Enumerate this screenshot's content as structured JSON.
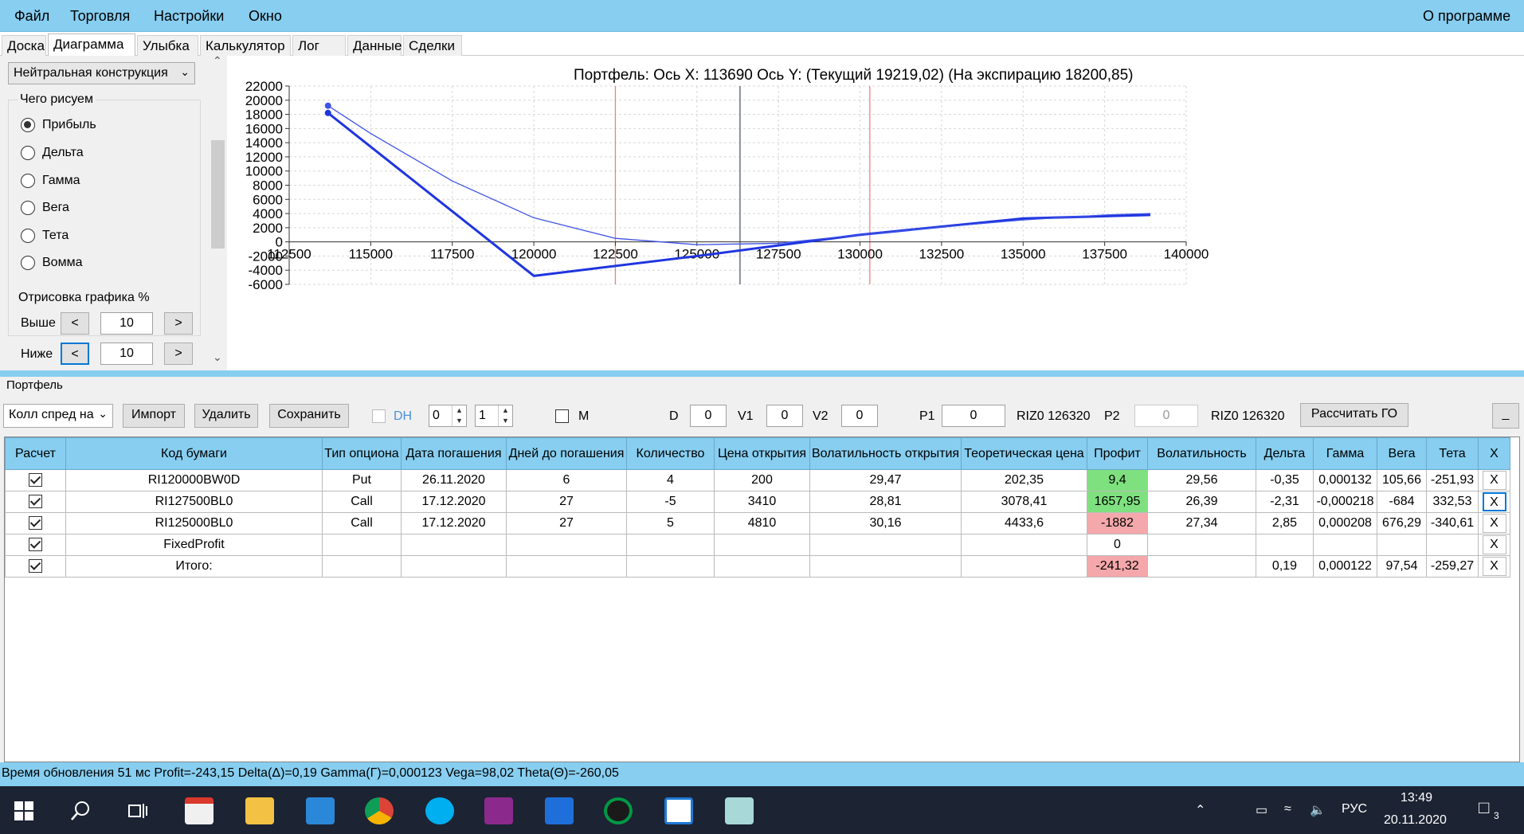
{
  "menu": {
    "file": "Файл",
    "trade": "Торговля",
    "settings": "Настройки",
    "window": "Окно",
    "about": "О программе"
  },
  "tabs": [
    "Доска",
    "Диаграмма",
    "Улыбка",
    "Калькулятор",
    "Лог",
    "Данные",
    "Сделки"
  ],
  "left_panel": {
    "construction": "Нейтральная конструкция",
    "draw_group_title": "Чего рисуем",
    "radios": [
      "Прибыль",
      "Дельта",
      "Гамма",
      "Вега",
      "Тета",
      "Вомма"
    ],
    "selected_radio": "Прибыль",
    "render_group_title": "Отрисовка графика %",
    "above_label": "Выше",
    "below_label": "Ниже",
    "prev": "<",
    "next": ">",
    "above_value": "10",
    "below_value": "10"
  },
  "chart_title": "Портфель: Ось X: 113690 Ось Y:  (Текущий 19219,02)  (На экспирацию 18200,85)",
  "chart_data": {
    "type": "line",
    "title": "Портфель: Ось X: 113690 Ось Y:  (Текущий 19219,02)  (На экспирацию 18200,85)",
    "xlim": [
      112500,
      140000
    ],
    "ylim": [
      -6000,
      22000
    ],
    "x_ticks": [
      112500,
      115000,
      117500,
      120000,
      122500,
      125000,
      127500,
      130000,
      132500,
      135000,
      137500,
      140000
    ],
    "y_ticks": [
      22000,
      20000,
      18000,
      16000,
      14000,
      12000,
      10000,
      8000,
      6000,
      4000,
      2000,
      0,
      -2000,
      -4000,
      -6000
    ],
    "grid": true,
    "current_price_line": 126320,
    "strike_lines": [
      122500,
      130300
    ],
    "series": [
      {
        "color": "#1f35e0",
        "width": 3,
        "x": [
          113690,
          120000,
          125000,
          130000,
          135000,
          138900
        ],
        "y": [
          18200,
          -4800,
          -2000,
          1000,
          3300,
          3800
        ]
      },
      {
        "color": "#3f54e6",
        "width": 1.3,
        "x": [
          113690,
          115000,
          117500,
          120000,
          122500,
          125000,
          127500,
          130000,
          132500,
          135000,
          137500,
          138900
        ],
        "y": [
          19219,
          15300,
          8600,
          3400,
          500,
          -400,
          -200,
          1000,
          2100,
          3100,
          3800,
          4000
        ]
      }
    ]
  },
  "portfolio": {
    "title": "Портфель",
    "strategy": "Колл спред на",
    "import": "Импорт",
    "delete": "Удалить",
    "save": "Сохранить",
    "dh": "DH",
    "spin1": "0",
    "spin2": "1",
    "m": "M",
    "d_label": "D",
    "d_value": "0",
    "v1_label": "V1",
    "v1_value": "0",
    "v2_label": "V2",
    "v2_value": "0",
    "p1_label": "P1",
    "p1_value": "0",
    "riz1": "RIZ0 126320",
    "p2_label": "P2",
    "p2_value": "0",
    "riz2": "RIZ0 126320",
    "calc": "Рассчитать ГО",
    "minimize": "_"
  },
  "table": {
    "headers": [
      "Расчет",
      "Код бумаги",
      "Тип опциона",
      "Дата погашения",
      "Дней до погашения",
      "Количество",
      "Цена открытия",
      "Волатильность открытия",
      "Теоретическая цена",
      "Профит",
      "Волатильность",
      "Дельта",
      "Гамма",
      "Вега",
      "Тета",
      "X"
    ],
    "rows": [
      {
        "code": "RI120000BW0D",
        "type": "Put",
        "date": "26.11.2020",
        "days": "6",
        "qty": "4",
        "price": "200",
        "open_vol": "29,47",
        "theo": "202,35",
        "profit": "9,4",
        "profit_status": "green",
        "vol": "29,56",
        "delta": "-0,35",
        "gamma": "0,000132",
        "vega": "105,66",
        "theta": "-251,93",
        "x": "X"
      },
      {
        "code": "RI127500BL0",
        "type": "Call",
        "date": "17.12.2020",
        "days": "27",
        "qty": "-5",
        "price": "3410",
        "open_vol": "28,81",
        "theo": "3078,41",
        "profit": "1657,95",
        "profit_status": "green",
        "vol": "26,39",
        "delta": "-2,31",
        "gamma": "-0,000218",
        "vega": "-684",
        "theta": "332,53",
        "x": "X"
      },
      {
        "code": "RI125000BL0",
        "type": "Call",
        "date": "17.12.2020",
        "days": "27",
        "qty": "5",
        "price": "4810",
        "open_vol": "30,16",
        "theo": "4433,6",
        "profit": "-1882",
        "profit_status": "red",
        "vol": "27,34",
        "delta": "2,85",
        "gamma": "0,000208",
        "vega": "676,29",
        "theta": "-340,61",
        "x": "X"
      },
      {
        "code": "FixedProfit",
        "type": "",
        "date": "",
        "days": "",
        "qty": "",
        "price": "",
        "open_vol": "",
        "theo": "",
        "profit": "0",
        "profit_status": "none",
        "vol": "",
        "delta": "",
        "gamma": "",
        "vega": "",
        "theta": "",
        "x": "X"
      },
      {
        "code": "Итого:",
        "type": "",
        "date": "",
        "days": "",
        "qty": "",
        "price": "",
        "open_vol": "",
        "theo": "",
        "profit": "-241,32",
        "profit_status": "red",
        "vol": "",
        "delta": "0,19",
        "gamma": "0,000122",
        "vega": "97,54",
        "theta": "-259,27",
        "x": "X"
      }
    ]
  },
  "status": "Время обновления 51 мс  Profit=-243,15 Delta(Δ)=0,19 Gamma(Γ)=0,000123 Vega=98,02 Theta(Θ)=-260,05",
  "taskbar": {
    "lang": "РУС",
    "time": "13:49",
    "date": "20.11.2020",
    "notifications": "3",
    "icons": [
      "start-icon",
      "search-icon",
      "task-view-icon",
      "store-icon",
      "explorer-icon",
      "mail-icon",
      "chrome-icon",
      "skype-icon",
      "winrar-icon",
      "video-icon",
      "qlik-icon",
      "trading-chart-icon",
      "notes-icon"
    ]
  },
  "colors": {
    "accent": "#87cef0",
    "green": "#7fe07f",
    "red": "#f5a8ab",
    "line": "#1f35e0"
  }
}
